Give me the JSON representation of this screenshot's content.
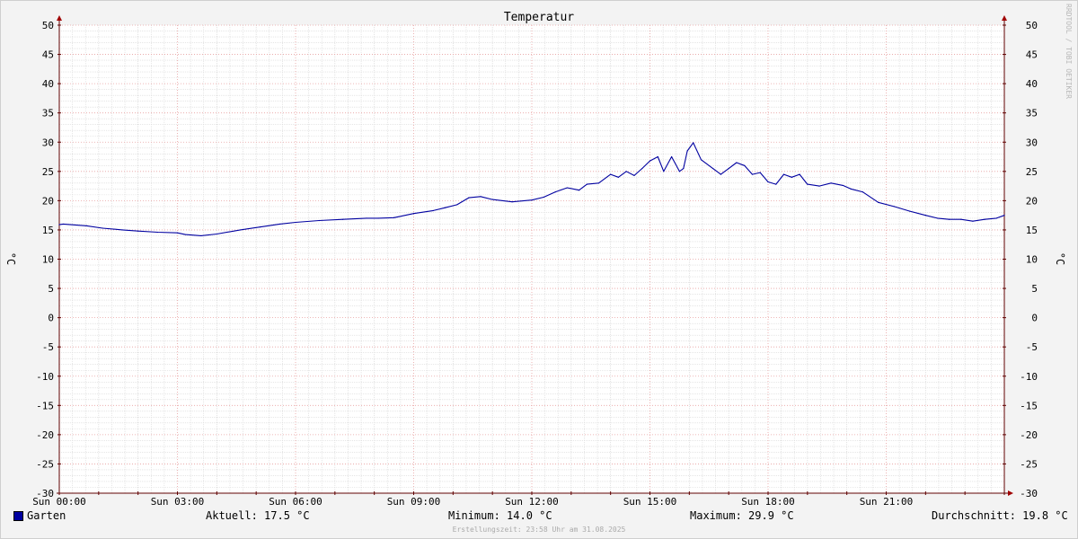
{
  "chart_data": {
    "type": "line",
    "title": "Temperatur",
    "ylabel": "°C",
    "ylim": [
      -30,
      50
    ],
    "yticks": [
      50,
      45,
      40,
      35,
      30,
      25,
      20,
      15,
      10,
      5,
      0,
      -5,
      -10,
      -15,
      -20,
      -25,
      -30
    ],
    "xlim": [
      0,
      24
    ],
    "xticks": [
      {
        "hour": 0,
        "label": "Sun 00:00"
      },
      {
        "hour": 3,
        "label": "Sun 03:00"
      },
      {
        "hour": 6,
        "label": "Sun 06:00"
      },
      {
        "hour": 9,
        "label": "Sun 09:00"
      },
      {
        "hour": 12,
        "label": "Sun 12:00"
      },
      {
        "hour": 15,
        "label": "Sun 15:00"
      },
      {
        "hour": 18,
        "label": "Sun 18:00"
      },
      {
        "hour": 21,
        "label": "Sun 21:00"
      }
    ],
    "grid": true,
    "series": [
      {
        "name": "Garten",
        "color": "#0000a0",
        "x": [
          0,
          0.1,
          0.7,
          1.1,
          1.6,
          2.0,
          2.5,
          3.0,
          3.2,
          3.6,
          4.0,
          4.6,
          5.1,
          5.6,
          6.0,
          6.6,
          7.2,
          7.8,
          8.1,
          8.5,
          9.0,
          9.5,
          9.8,
          10.1,
          10.4,
          10.7,
          11.0,
          11.5,
          12.0,
          12.3,
          12.6,
          12.9,
          13.2,
          13.4,
          13.7,
          14.0,
          14.2,
          14.4,
          14.6,
          14.8,
          15.0,
          15.2,
          15.35,
          15.55,
          15.75,
          15.85,
          15.95,
          16.1,
          16.3,
          16.6,
          16.8,
          17.0,
          17.2,
          17.4,
          17.6,
          17.8,
          18.0,
          18.2,
          18.4,
          18.6,
          18.8,
          19.0,
          19.3,
          19.6,
          19.9,
          20.1,
          20.4,
          20.8,
          21.2,
          21.6,
          22.0,
          22.3,
          22.6,
          22.9,
          23.2,
          23.5,
          23.8,
          24.0
        ],
        "y": [
          15.9,
          16.0,
          15.7,
          15.3,
          15.0,
          14.8,
          14.6,
          14.5,
          14.2,
          14.0,
          14.3,
          15.0,
          15.5,
          16.0,
          16.3,
          16.6,
          16.8,
          17.0,
          17.0,
          17.1,
          17.8,
          18.3,
          18.8,
          19.3,
          20.5,
          20.7,
          20.2,
          19.8,
          20.1,
          20.6,
          21.5,
          22.2,
          21.8,
          22.8,
          23.0,
          24.5,
          24.0,
          25.0,
          24.3,
          25.5,
          26.8,
          27.5,
          25.0,
          27.5,
          25.0,
          25.5,
          28.5,
          29.9,
          27.0,
          25.5,
          24.5,
          25.5,
          26.5,
          26.0,
          24.5,
          24.8,
          23.2,
          22.8,
          24.5,
          24.0,
          24.5,
          22.8,
          22.5,
          23.0,
          22.6,
          22.0,
          21.5,
          19.7,
          19.0,
          18.2,
          17.5,
          17.0,
          16.8,
          16.8,
          16.5,
          16.8,
          17.0,
          17.5
        ]
      }
    ]
  },
  "legend": {
    "series_name": "Garten",
    "aktuell": "Aktuell: 17.5 °C",
    "minimum": "Minimum: 14.0 °C",
    "maximum": "Maximum: 29.9 °C",
    "durchschnitt": "Durchschnitt: 19.8 °C"
  },
  "footer": "Erstellungszeit: 23:58 Uhr am 31.08.2025",
  "watermark": "RRDTOOL / TOBI OETIKER",
  "colors": {
    "line": "#0000a0",
    "major_grid": "#e8a0a0",
    "minor_grid": "#d6d6d6",
    "axis": "#600000"
  }
}
